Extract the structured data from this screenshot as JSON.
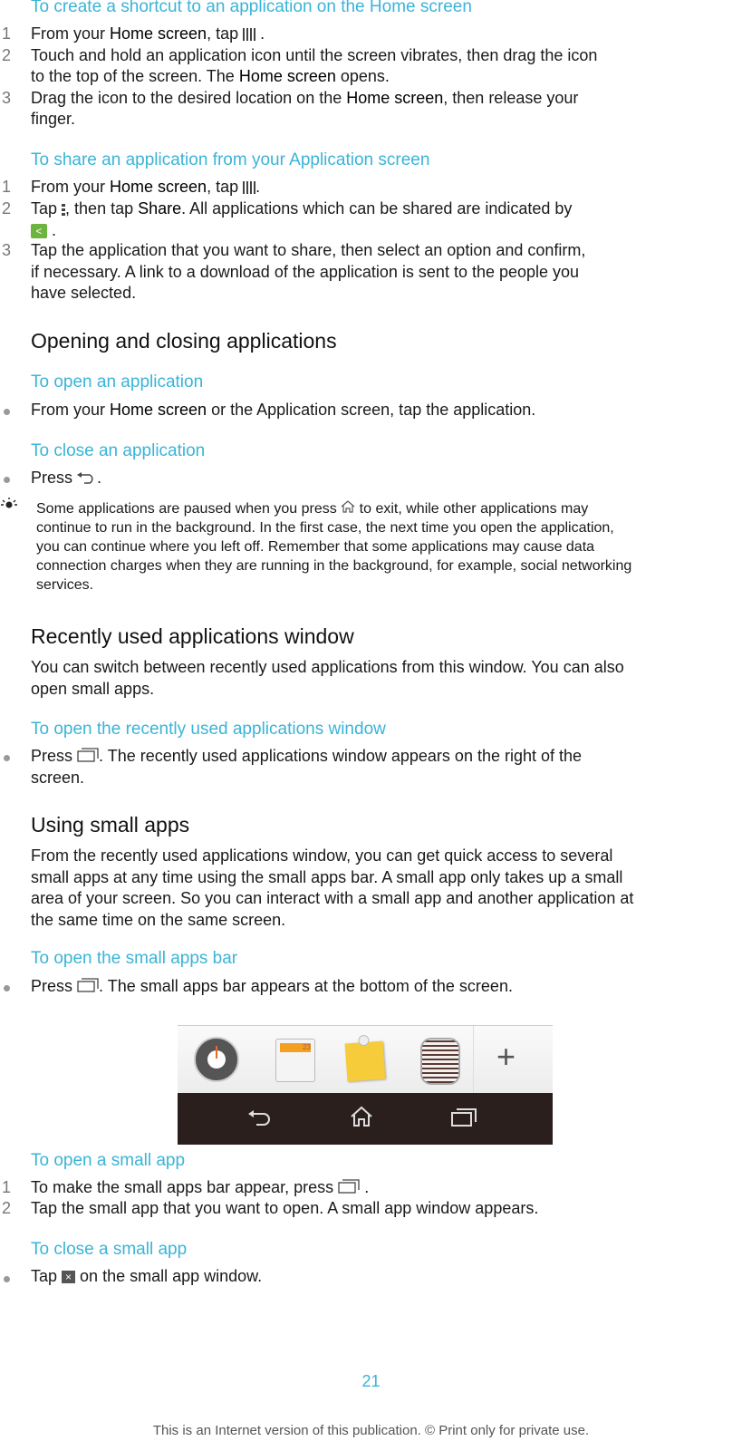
{
  "sections": {
    "shortcut": {
      "heading": "To create a shortcut to an application on the Home screen",
      "steps": [
        {
          "n": "1",
          "pre": "From your ",
          "bold": "Home screen",
          "post": ", tap",
          "tail": " ."
        },
        {
          "n": "2",
          "line1a": "Touch and hold an application icon until the screen vibrates, then drag the icon",
          "line2a": "to the top of the screen. The ",
          "bold": "Home screen",
          "line2b": " opens."
        },
        {
          "n": "3",
          "line1a": "Drag the icon to the desired location on the ",
          "bold": "Home screen",
          "line1b": ", then release your",
          "line2": "finger."
        }
      ]
    },
    "share": {
      "heading": "To share an application from your Application screen",
      "steps": [
        {
          "n": "1",
          "pre": "From your ",
          "bold": "Home screen",
          "post": ", tap",
          "tail": "."
        },
        {
          "n": "2",
          "pre": "Tap",
          "mid": ", then tap ",
          "bold": "Share",
          "post": ". All applications which can be shared are indicated by",
          "tail": "."
        },
        {
          "n": "3",
          "line1": "Tap the application that you want to share, then select an option and confirm,",
          "line2": "if necessary. A link to a download of the application is sent to the people you",
          "line3": "have selected."
        }
      ]
    },
    "opening": {
      "title": "Opening and closing applications",
      "open_heading": "To open an application",
      "open_pre": "From your ",
      "open_bold": "Home screen",
      "open_post": " or the Application screen, tap the application.",
      "close_heading": "To close an application",
      "close_pre": "Press",
      "close_post": ".",
      "note": [
        {
          "pre": "Some applications are paused when you press",
          "post": " to exit, while other applications may"
        },
        {
          "text": "continue to run in the background. In the first case, the next time you open the application,"
        },
        {
          "text": "you can continue where you left off. Remember that some applications may cause data"
        },
        {
          "text": "connection charges when they are running in the background, for example, social networking"
        },
        {
          "text": "services."
        }
      ]
    },
    "recent": {
      "title": "Recently used applications window",
      "body1": "You can switch between recently used applications from this window. You can also",
      "body2": "open small apps.",
      "heading": "To open the recently used applications window",
      "pre": "Press",
      "post": ". The recently used applications window appears on the right of the",
      "post2": "screen."
    },
    "small": {
      "title": "Using small apps",
      "body": [
        "From the recently used applications window, you can get quick access to several",
        "small apps at any time using the small apps bar. A small app only takes up a small",
        "area of your screen. So you can interact with a small app and another application at",
        "the same time on the same screen."
      ],
      "bar_heading": "To open the small apps bar",
      "bar_pre": "Press",
      "bar_post": ". The small apps bar appears at the bottom of the screen.",
      "screenshot": {
        "apps": [
          "timer",
          "calculator",
          "notes",
          "voice-recorder"
        ],
        "calc_display": "23",
        "add_label": "+"
      },
      "open_heading": "To open a small app",
      "open_steps": [
        {
          "n": "1",
          "pre": "To make the small apps bar appear, press",
          "post": " ."
        },
        {
          "n": "2",
          "text": "Tap the small app that you want to open. A small app window appears."
        }
      ],
      "close_heading": "To close a small app",
      "close_pre": "Tap",
      "close_post": " on the small app window."
    }
  },
  "footer": {
    "page_number": "21",
    "notice": "This is an Internet version of this publication. © Print only for private use."
  },
  "colors": {
    "accent": "#3ab4d8",
    "share_green": "#6cb33f",
    "navbar": "#2b1f1e"
  }
}
